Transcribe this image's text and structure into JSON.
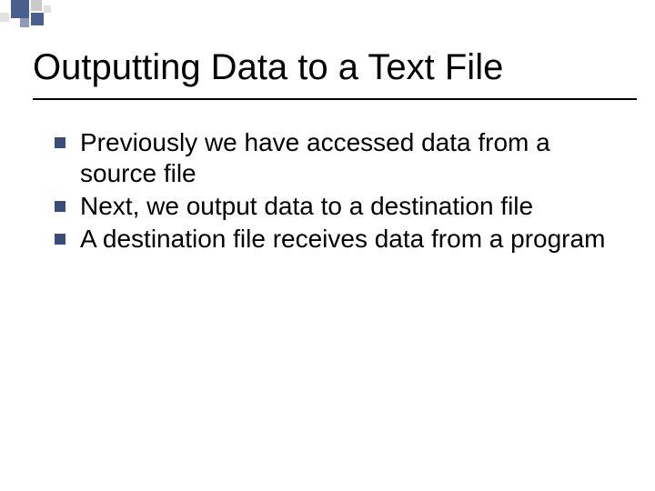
{
  "colors": {
    "bullet": "#3a4c7a",
    "deco_blue": "#4a5f8e",
    "deco_blue_light": "#8f9bb9",
    "deco_gray": "#c9c9c9",
    "deco_gray_light": "#e2e2e2"
  },
  "title": "Outputting Data to a Text File",
  "bullets": [
    "Previously we have accessed data from a source file",
    "Next, we output data to a destination file",
    "A destination file receives data from a program"
  ]
}
